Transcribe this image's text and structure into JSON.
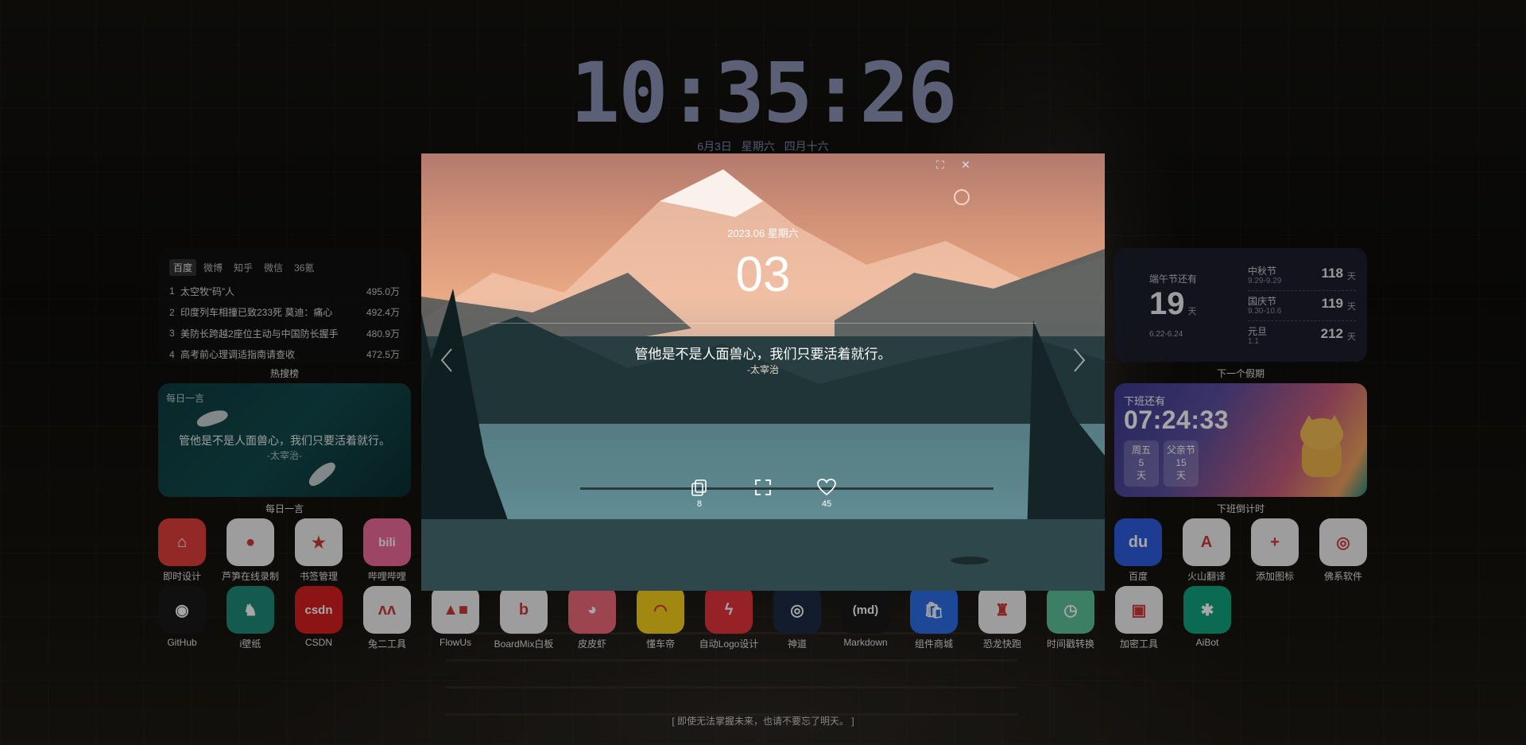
{
  "clock": {
    "time": "10:35:26",
    "date": "6月3日",
    "weekday": "星期六",
    "lunar": "四月十六"
  },
  "hot_search": {
    "tabs": [
      "百度",
      "微博",
      "知乎",
      "微信",
      "36氪"
    ],
    "items": [
      {
        "rank": "1",
        "title": "太空牧“码”人",
        "heat": "495.0万"
      },
      {
        "rank": "2",
        "title": "印度列车相撞已致233死 莫迪：痛心",
        "heat": "492.4万"
      },
      {
        "rank": "3",
        "title": "美防长跨越2座位主动与中国防长握手",
        "heat": "480.9万"
      },
      {
        "rank": "4",
        "title": "高考前心理调适指南请查收",
        "heat": "472.5万"
      }
    ],
    "caption": "热搜榜"
  },
  "daily_quote": {
    "label": "每日一言",
    "text": "管他是不是人面兽心，我们只要活着就行。",
    "author": "-太宰治-",
    "caption": "每日一言"
  },
  "holiday": {
    "current_label": "端午节还有",
    "current_days": "19",
    "unit": "天",
    "current_range": "6.22-6.24",
    "items": [
      {
        "name": "中秋节",
        "range": "9.29-9.29",
        "days": "118"
      },
      {
        "name": "国庆节",
        "range": "9.30-10.6",
        "days": "119"
      },
      {
        "name": "元旦",
        "range": "1.1",
        "days": "212"
      }
    ],
    "caption": "下一个假期"
  },
  "offwork": {
    "label": "下班还有",
    "time": "07:24:33",
    "box1": {
      "name": "周五",
      "value": "5",
      "unit": "天"
    },
    "box2": {
      "name": "父亲节",
      "value": "15",
      "unit": "天"
    },
    "caption": "下班倒计时"
  },
  "apps_left": [
    {
      "label": "即时设计",
      "glyph": "⌂",
      "color": "#e0403b"
    },
    {
      "label": "芦笋在线录制",
      "glyph": "●",
      "color": "#f2f2f2"
    },
    {
      "label": "书签管理",
      "glyph": "★",
      "color": "#f0f0f0"
    },
    {
      "label": "哔哩哔哩",
      "glyph": "bili",
      "color": "#f06a9b"
    }
  ],
  "apps_right": [
    {
      "label": "百度",
      "glyph": "du",
      "color": "#2f5fe0"
    },
    {
      "label": "火山翻译",
      "glyph": "A",
      "color": "#f2f2f2"
    },
    {
      "label": "添加图标",
      "glyph": "+",
      "color": "#f2f2f2"
    },
    {
      "label": "佛系软件",
      "glyph": "◎",
      "color": "#f2f2f2"
    }
  ],
  "apps_bottom": [
    {
      "label": "GitHub",
      "glyph": "◉",
      "color": "#1a1a1a"
    },
    {
      "label": "i壁纸",
      "glyph": "♞",
      "color": "#1f8b78"
    },
    {
      "label": "CSDN",
      "glyph": "csdn",
      "color": "#d71f1f"
    },
    {
      "label": "兔二工具",
      "glyph": "ʌʌ",
      "color": "#f2f2f2"
    },
    {
      "label": "FlowUs",
      "glyph": "▲■",
      "color": "#f2f2f2"
    },
    {
      "label": "BoardMix白板",
      "glyph": "b",
      "color": "#f2f2f2"
    },
    {
      "label": "皮皮虾",
      "glyph": "◕",
      "color": "#f06a7a"
    },
    {
      "label": "懂车帝",
      "glyph": "◠",
      "color": "#f7d21a"
    },
    {
      "label": "自动Logo设计",
      "glyph": "ϟ",
      "color": "#e6333c"
    },
    {
      "label": "神道",
      "glyph": "◎",
      "color": "#1c2b44"
    },
    {
      "label": "Markdown",
      "glyph": "(md)",
      "color": "#1a1a1a"
    },
    {
      "label": "组件商城",
      "glyph": "🛍",
      "color": "#2d6fe8"
    },
    {
      "label": "恐龙快跑",
      "glyph": "♜",
      "color": "#f2f2f2"
    },
    {
      "label": "时间戳转换",
      "glyph": "◷",
      "color": "#5fc39a"
    },
    {
      "label": "加密工具",
      "glyph": "▣",
      "color": "#f2f2f2"
    },
    {
      "label": "AiBot",
      "glyph": "✱",
      "color": "#10a37f"
    }
  ],
  "bottom_quote": "[ 即使无法掌握未来，也请不要忘了明天。 ]",
  "modal": {
    "date": "2023.06 星期六",
    "day": "03",
    "quote": "管他是不是人面兽心，我们只要活着就行。",
    "author": "-太宰治",
    "copy_count": "8",
    "like_count": "45"
  }
}
